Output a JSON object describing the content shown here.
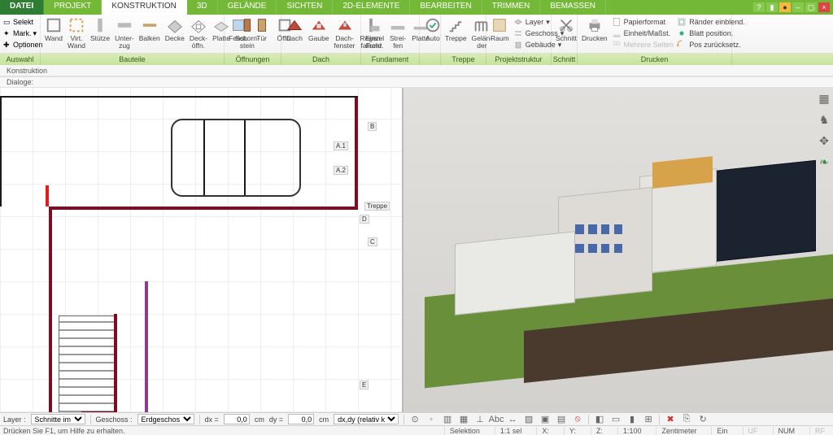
{
  "tabs": {
    "file": "DATEI",
    "list": [
      "PROJEKT",
      "KONSTRUKTION",
      "3D",
      "GELÄNDE",
      "SICHTEN",
      "2D-ELEMENTE",
      "BEARBEITEN",
      "TRIMMEN",
      "BEMASSEN"
    ],
    "active_index": 1
  },
  "selection_panel": {
    "selekt": "Selekt",
    "mark": "Mark.",
    "optionen": "Optionen"
  },
  "ribbon": {
    "bauteile": [
      "Wand",
      "Virt.\nWand",
      "Stütze",
      "Unter-\nzug",
      "Balken",
      "Decke",
      "Deck-\nöffn.",
      "Platte",
      "Schorn-\nstein"
    ],
    "oeffnungen": [
      "Fenst.",
      "Tür",
      "Öffn."
    ],
    "dach": [
      "Dach",
      "Gaube",
      "Dach-\nfenster",
      "Regen-\nfallrohr"
    ],
    "fundament": [
      "Einzel\nFund.",
      "Strei-\nfen",
      "Platte"
    ],
    "auto": "Auto",
    "treppe": [
      "Treppe",
      "Gelän-\nder"
    ],
    "projektstruktur": {
      "raum": "Raum",
      "layer": "Layer",
      "geschoss": "Geschoss",
      "gebaeude": "Gebäude"
    },
    "schnitt": "Schnitt",
    "drucken": {
      "btn": "Drucken",
      "papier": "Papierformat",
      "einheit": "Einheit/Maßst.",
      "mehrere": "Mehrere Seiten",
      "raender": "Ränder einblend.",
      "blatt": "Blatt position.",
      "pos": "Pos zurücksetz."
    }
  },
  "groups": [
    "Auswahl",
    "Bauteile",
    "Öffnungen",
    "Dach",
    "Fundament",
    "",
    "Treppe",
    "Projektstruktur",
    "Schnitt",
    "Drucken"
  ],
  "subbars": {
    "konstruktion": "Konstruktion",
    "dialoge": "Dialoge:"
  },
  "plan_tags": {
    "a1": "A.1",
    "a2": "A.2",
    "b": "B",
    "c": "C",
    "d": "D",
    "e": "E",
    "treppe": "Treppe"
  },
  "bottom": {
    "layer_lbl": "Layer :",
    "layer_val": "Schnitte im",
    "geschoss_lbl": "Geschoss :",
    "geschoss_val": "Erdgeschos",
    "dx": "dx =",
    "dy": "dy =",
    "val": "0,0",
    "unit": "cm",
    "mode": "dx,dy (relativ ka"
  },
  "status": {
    "help": "Drücken Sie F1, um Hilfe zu erhalten.",
    "sel": "Selektion",
    "ratio": "1:1 sel",
    "x": "X:",
    "y": "Y:",
    "z": "Z:",
    "scale": "1:100",
    "unit": "Zentimeter",
    "ein": "Ein",
    "uf": "UF",
    "num": "NUM",
    "rf": "RF"
  }
}
